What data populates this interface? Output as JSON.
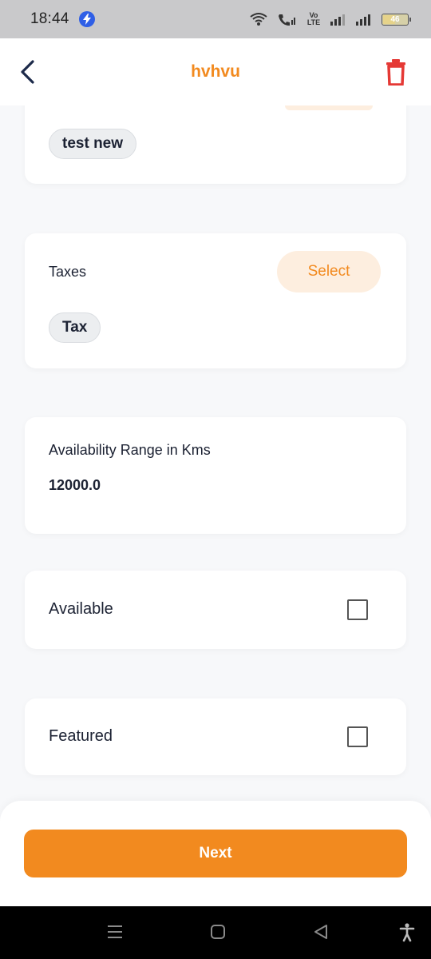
{
  "status_bar": {
    "time": "18:44",
    "battery": "46",
    "volte": "Vo LTE"
  },
  "app_bar": {
    "title": "hvhvu",
    "back_icon": "chevron-left-icon",
    "delete_icon": "trash-icon",
    "accent_color": "#f28a1f",
    "delete_color": "#e53935"
  },
  "sections": {
    "add_ons": {
      "chip": "test new"
    },
    "taxes": {
      "label": "Taxes",
      "select_label": "Select",
      "chip": "Tax"
    },
    "availability_range": {
      "label": "Availability Range in Kms",
      "value": "12000.0"
    },
    "available": {
      "label": "Available",
      "checked": false
    },
    "featured": {
      "label": "Featured",
      "checked": false
    }
  },
  "footer": {
    "next_label": "Next",
    "button_color": "#f28a1f"
  },
  "system_nav": {
    "recents_icon": "recents-icon",
    "home_icon": "home-icon",
    "back_icon": "back-triangle-icon",
    "accessibility_icon": "accessibility-icon"
  }
}
